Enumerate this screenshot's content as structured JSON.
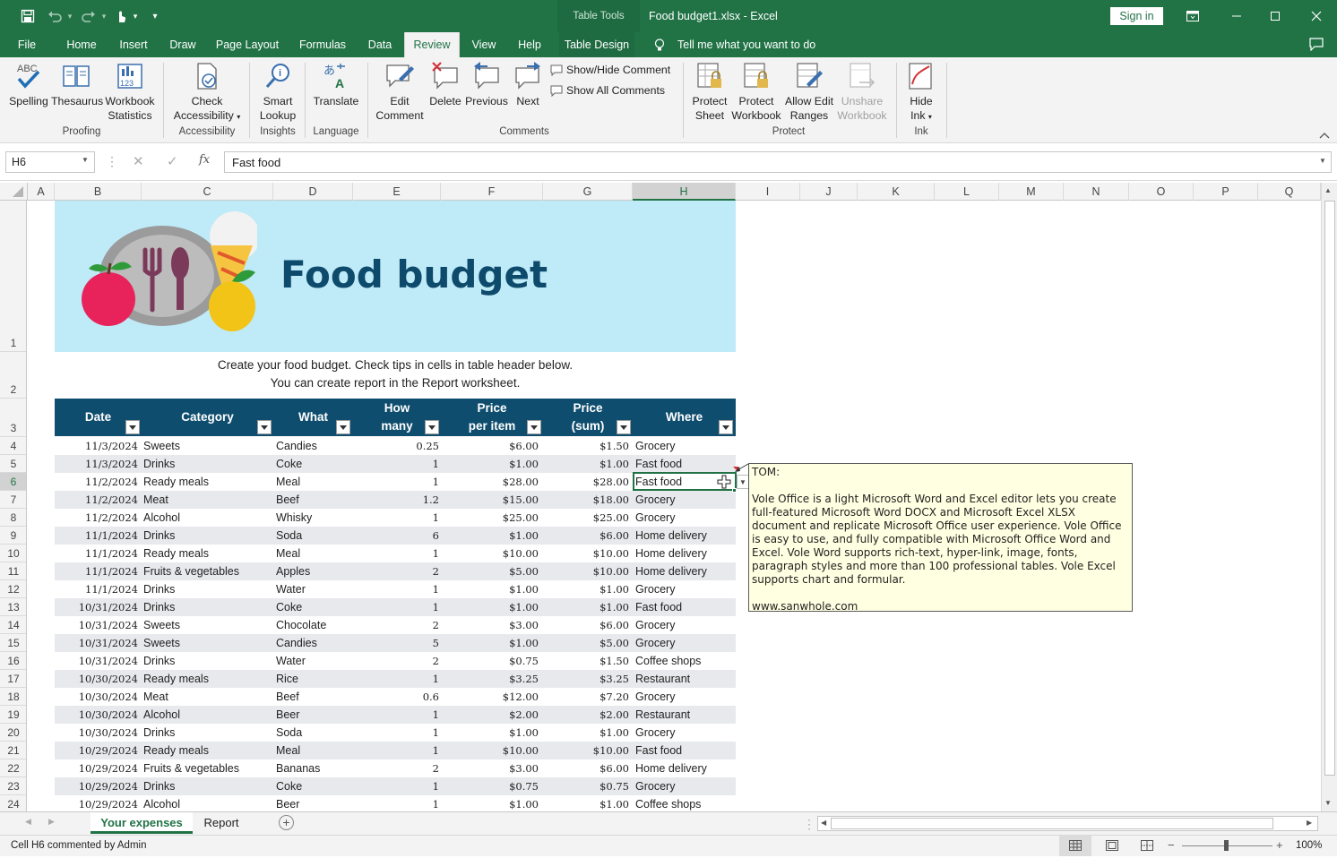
{
  "window": {
    "table_tools": "Table Tools",
    "title": "Food budget1.xlsx  -  Excel",
    "sign_in": "Sign in"
  },
  "tabs": [
    {
      "label": "File"
    },
    {
      "label": "Home"
    },
    {
      "label": "Insert"
    },
    {
      "label": "Draw"
    },
    {
      "label": "Page Layout"
    },
    {
      "label": "Formulas"
    },
    {
      "label": "Data"
    },
    {
      "label": "Review"
    },
    {
      "label": "View"
    },
    {
      "label": "Help"
    },
    {
      "label": "Table Design"
    }
  ],
  "tell_me": "Tell me what you want to do",
  "ribbon": {
    "spelling": "Spelling",
    "thesaurus": "Thesaurus",
    "workbook_l1": "Workbook",
    "workbook_l2": "Statistics",
    "proofing": "Proofing",
    "check_l1": "Check",
    "check_l2": "Accessibility",
    "accessibility": "Accessibility",
    "smart_l1": "Smart",
    "smart_l2": "Lookup",
    "insights": "Insights",
    "translate": "Translate",
    "language": "Language",
    "edit_l1": "Edit",
    "edit_l2": "Comment",
    "delete": "Delete",
    "previous": "Previous",
    "next": "Next",
    "show_hide_comment": "Show/Hide Comment",
    "show_all_comments": "Show All Comments",
    "comments": "Comments",
    "protect_sheet_l1": "Protect",
    "protect_sheet_l2": "Sheet",
    "protect_wb_l1": "Protect",
    "protect_wb_l2": "Workbook",
    "allow_l1": "Allow Edit",
    "allow_l2": "Ranges",
    "unshare_l1": "Unshare",
    "unshare_l2": "Workbook",
    "protect": "Protect",
    "hide_l1": "Hide",
    "hide_l2": "Ink",
    "ink": "Ink"
  },
  "formula_bar": {
    "name_box": "H6",
    "fx": "fx",
    "value": "Fast food"
  },
  "columns": [
    "A",
    "B",
    "C",
    "D",
    "E",
    "F",
    "G",
    "H",
    "I",
    "J",
    "K",
    "L",
    "M",
    "N",
    "O",
    "P",
    "Q"
  ],
  "rows": [
    "1",
    "2",
    "3",
    "4",
    "5",
    "6",
    "7",
    "8",
    "9",
    "10",
    "11",
    "12",
    "13",
    "14",
    "15",
    "16",
    "17",
    "18",
    "19",
    "20",
    "21",
    "22",
    "23",
    "24"
  ],
  "sheet": {
    "title": "Food budget",
    "note_line1": "Create your food budget. Check tips in cells in table header below.",
    "note_line2": "You can create report in the Report worksheet.",
    "headers": {
      "date": "Date",
      "category": "Category",
      "what": "What",
      "how_l1": "How",
      "how_l2": "many",
      "ppi_l1": "Price",
      "ppi_l2": "per item",
      "sum_l1": "Price",
      "sum_l2": "(sum)",
      "where": "Where"
    },
    "rows": [
      {
        "date": "11/3/2024",
        "category": "Sweets",
        "what": "Candies",
        "qty": "0.25",
        "price": "$6.00",
        "sum": "$1.50",
        "where": "Grocery"
      },
      {
        "date": "11/3/2024",
        "category": "Drinks",
        "what": "Coke",
        "qty": "1",
        "price": "$1.00",
        "sum": "$1.00",
        "where": "Fast food"
      },
      {
        "date": "11/2/2024",
        "category": "Ready meals",
        "what": "Meal",
        "qty": "1",
        "price": "$28.00",
        "sum": "$28.00",
        "where": "Fast food"
      },
      {
        "date": "11/2/2024",
        "category": "Meat",
        "what": "Beef",
        "qty": "1.2",
        "price": "$15.00",
        "sum": "$18.00",
        "where": "Grocery"
      },
      {
        "date": "11/2/2024",
        "category": "Alcohol",
        "what": "Whisky",
        "qty": "1",
        "price": "$25.00",
        "sum": "$25.00",
        "where": "Grocery"
      },
      {
        "date": "11/1/2024",
        "category": "Drinks",
        "what": "Soda",
        "qty": "6",
        "price": "$1.00",
        "sum": "$6.00",
        "where": "Home delivery"
      },
      {
        "date": "11/1/2024",
        "category": "Ready meals",
        "what": "Meal",
        "qty": "1",
        "price": "$10.00",
        "sum": "$10.00",
        "where": "Home delivery"
      },
      {
        "date": "11/1/2024",
        "category": "Fruits & vegetables",
        "what": "Apples",
        "qty": "2",
        "price": "$5.00",
        "sum": "$10.00",
        "where": "Home delivery"
      },
      {
        "date": "11/1/2024",
        "category": "Drinks",
        "what": "Water",
        "qty": "1",
        "price": "$1.00",
        "sum": "$1.00",
        "where": "Grocery"
      },
      {
        "date": "10/31/2024",
        "category": "Drinks",
        "what": "Coke",
        "qty": "1",
        "price": "$1.00",
        "sum": "$1.00",
        "where": "Fast food"
      },
      {
        "date": "10/31/2024",
        "category": "Sweets",
        "what": "Chocolate",
        "qty": "2",
        "price": "$3.00",
        "sum": "$6.00",
        "where": "Grocery"
      },
      {
        "date": "10/31/2024",
        "category": "Sweets",
        "what": "Candies",
        "qty": "5",
        "price": "$1.00",
        "sum": "$5.00",
        "where": "Grocery"
      },
      {
        "date": "10/31/2024",
        "category": "Drinks",
        "what": "Water",
        "qty": "2",
        "price": "$0.75",
        "sum": "$1.50",
        "where": "Coffee shops"
      },
      {
        "date": "10/30/2024",
        "category": "Ready meals",
        "what": "Rice",
        "qty": "1",
        "price": "$3.25",
        "sum": "$3.25",
        "where": "Restaurant"
      },
      {
        "date": "10/30/2024",
        "category": "Meat",
        "what": "Beef",
        "qty": "0.6",
        "price": "$12.00",
        "sum": "$7.20",
        "where": "Grocery"
      },
      {
        "date": "10/30/2024",
        "category": "Alcohol",
        "what": "Beer",
        "qty": "1",
        "price": "$2.00",
        "sum": "$2.00",
        "where": "Restaurant"
      },
      {
        "date": "10/30/2024",
        "category": "Drinks",
        "what": "Soda",
        "qty": "1",
        "price": "$1.00",
        "sum": "$1.00",
        "where": "Grocery"
      },
      {
        "date": "10/29/2024",
        "category": "Ready meals",
        "what": "Meal",
        "qty": "1",
        "price": "$10.00",
        "sum": "$10.00",
        "where": "Fast food"
      },
      {
        "date": "10/29/2024",
        "category": "Fruits & vegetables",
        "what": "Bananas",
        "qty": "2",
        "price": "$3.00",
        "sum": "$6.00",
        "where": "Home delivery"
      },
      {
        "date": "10/29/2024",
        "category": "Drinks",
        "what": "Coke",
        "qty": "1",
        "price": "$0.75",
        "sum": "$0.75",
        "where": "Grocery"
      },
      {
        "date": "10/29/2024",
        "category": "Alcohol",
        "what": "Beer",
        "qty": "1",
        "price": "$1.00",
        "sum": "$1.00",
        "where": "Coffee shops"
      }
    ]
  },
  "comment": {
    "author": "TOM:",
    "body": "Vole Office is a light Microsoft Word and Excel editor lets you create full-featured Microsoft Word DOCX and Microsoft Excel XLSX document and replicate Microsoft Office user experience. Vole Office is easy to use, and fully compatible with Microsoft Office Word and Excel. Vole Word supports rich-text, hyper-link, image, fonts, paragraph styles and more than 100 professional tables. Vole Excel supports chart and formular.",
    "link": "www.sanwhole.com"
  },
  "sheet_tabs": {
    "active": "Your expenses",
    "other": "Report"
  },
  "status": {
    "message": "Cell H6 commented by Admin",
    "zoom": "100%"
  },
  "colors": {
    "accent": "#217346",
    "header_fill": "#0e4d6e",
    "banner": "#bfeaf7",
    "comment_bg": "#ffffe1"
  }
}
